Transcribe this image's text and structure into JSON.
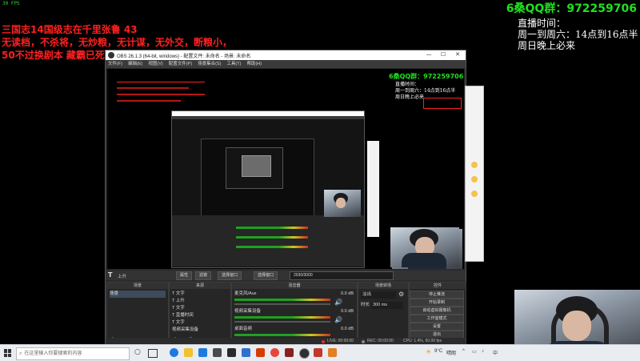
{
  "overlay": {
    "fps": "30 FPS",
    "red_lines": [
      "三国志14国级志在千里张鲁 43",
      "无读档，不杀将，无炒粮，无计谋，无外交，断粮小，",
      "50不过换剧本 藏霸已死[]"
    ],
    "qq_label": "6桑QQ群：",
    "qq_number": "972259706",
    "schedule": [
      "直播时间：",
      "周一到周六：14点到16点半",
      "周日晚上必来"
    ]
  },
  "obs": {
    "title": "OBS 26.1.3 (64-bit, windows) - 配置文件: 未命名 - 场景: 未命名",
    "menu": [
      "文件(F)",
      "编辑(E)",
      "视图(V)",
      "配置文件(P)",
      "场景集合(S)",
      "工具(T)",
      "帮助(H)"
    ],
    "scene_bar": {
      "scene_icon": "T",
      "scene_label": "上升",
      "properties": "属性",
      "filters": "滤镜",
      "select_window": "选择窗口",
      "select_window2": "选择窗口",
      "value": "2030/3000"
    },
    "docks": {
      "scenes": {
        "title": "场景",
        "items": [
          "场景"
        ]
      },
      "sources": {
        "title": "来源",
        "items": [
          "T 文字",
          "T 上升",
          "T 文字",
          "T 直播时间",
          "T 文字",
          "视频采集设备"
        ]
      },
      "mixer": {
        "title": "混音器",
        "tracks": [
          {
            "name": "麦克风/Aux",
            "db": "0.0 dB"
          },
          {
            "name": "视频采集设备",
            "db": "0.0 dB"
          },
          {
            "name": "桌面音频",
            "db": "0.0 dB"
          }
        ]
      },
      "transitions": {
        "title": "场景转场",
        "mode": "淡出",
        "duration_label": "时长",
        "duration": "300 ms"
      },
      "controls": {
        "title": "控件",
        "buttons": [
          "停止推流",
          "开始录制",
          "启动虚拟摄像机",
          "工作室模式",
          "设置",
          "退出"
        ]
      }
    },
    "status": {
      "live": "LIVE: 00:00:00",
      "rec": "REC: 00:00:00",
      "cpu": "CPU: 1.4%, 60.00 fps"
    }
  },
  "taskbar": {
    "search_placeholder": "在这里输入你要搜索的内容",
    "weather": "9°C",
    "weather_desc": "晴朗",
    "ime": "中",
    "time": "",
    "colors": {
      "edge": "#1f7ae0",
      "chrome": "#e8453c",
      "explorer": "#f2c12e",
      "obs": "#2f2f2f",
      "store": "#1f7ae0",
      "office": "#d83b01"
    }
  }
}
